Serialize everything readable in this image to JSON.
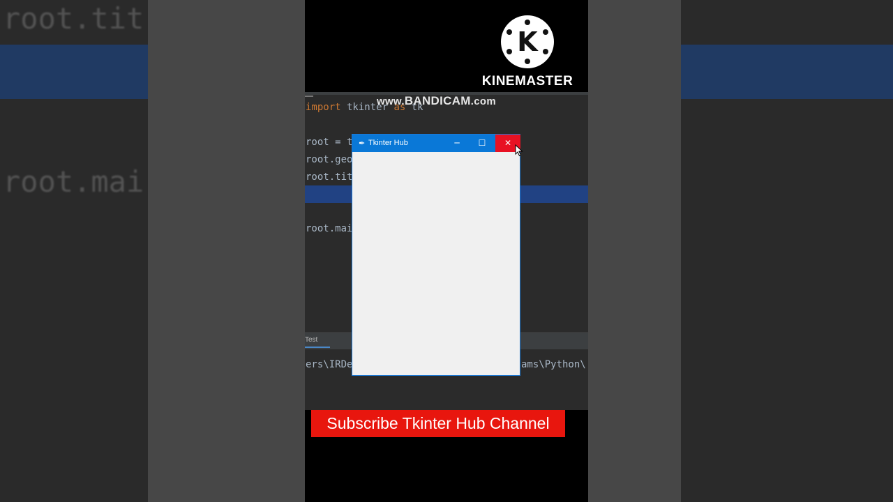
{
  "background": {
    "left_text_1": "root.tit",
    "left_text_2": "root.mai"
  },
  "watermark": {
    "app_name": "KINEMASTER",
    "logo_letter": "K",
    "recorder_prefix": "www.",
    "recorder_name": "BANDICAM",
    "recorder_suffix": ".com"
  },
  "editor": {
    "lines": [
      {
        "keyword": "import",
        "text": " tkinter ",
        "keyword2": "as",
        "text2": " tk"
      },
      {
        "text": "root = t"
      },
      {
        "text": "root.geo"
      },
      {
        "text": "root.tit"
      },
      {
        "text": "root.mai"
      }
    ],
    "run_tab_label": "Test",
    "console_left": "ers\\IRDe",
    "console_right": "ams\\Python\\"
  },
  "tk_window": {
    "title": "Tkinter Hub",
    "minimize_glyph": "─",
    "maximize_glyph": "☐",
    "close_glyph": "✕",
    "feather_glyph": "✒"
  },
  "banner": {
    "text": "Subscribe Tkinter Hub Channel"
  },
  "colors": {
    "titlebar": "#0a78d7",
    "close_hover": "#e81123",
    "banner": "#e8160e",
    "selection": "#214283"
  }
}
